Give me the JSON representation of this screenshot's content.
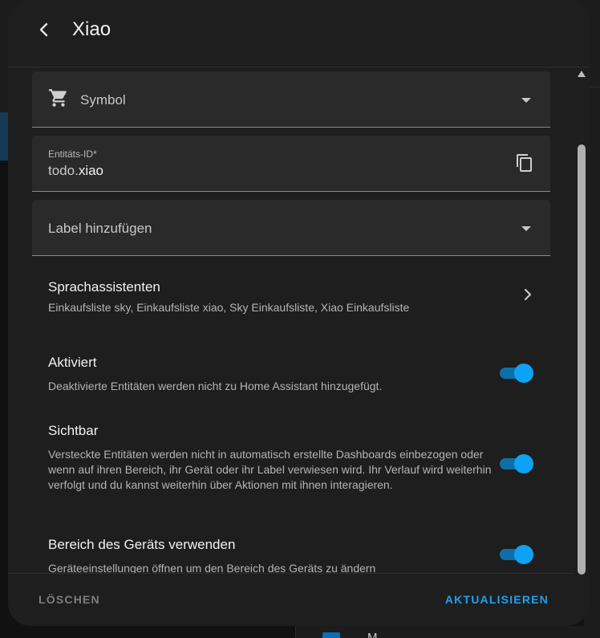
{
  "dialog": {
    "title": "Xiao"
  },
  "icon_field": {
    "label": "Symbol",
    "icon": "cart-icon"
  },
  "entity_field": {
    "label": "Entitäts-ID*",
    "prefix": "todo.",
    "value": "xiao"
  },
  "label_field": {
    "label": "Label hinzufügen"
  },
  "voice_assistants": {
    "title": "Sprachassistenten",
    "description": "Einkaufsliste sky, Einkaufsliste xiao, Sky Einkaufsliste, Xiao Einkaufsliste"
  },
  "settings": {
    "enabled": {
      "title": "Aktiviert",
      "description": "Deaktivierte Entitäten werden nicht zu Home Assistant hinzugefügt.",
      "on": true
    },
    "visible": {
      "title": "Sichtbar",
      "description": "Versteckte Entitäten werden nicht in automatisch erstellte Dashboards einbezogen oder wenn auf ihren Bereich, ihr Gerät oder ihr Label verwiesen wird. Ihr Verlauf wird weiterhin verfolgt und du kannst weiterhin über Aktionen mit ihnen interagieren.",
      "on": true
    },
    "device_area": {
      "title": "Bereich des Geräts verwenden",
      "description": "Geräteeinstellungen öffnen um den Bereich des Geräts zu ändern",
      "on": true
    }
  },
  "footer": {
    "delete_label": "LÖSCHEN",
    "update_label": "AKTUALISIEREN"
  },
  "background": {
    "row_text": "M"
  },
  "colors": {
    "accent": "#1ea1f2",
    "toggle_track": "#0e6fa8",
    "toggle_knob": "#0ea2f4",
    "dialog_bg": "#1e1e1e",
    "field_bg": "#2a2a2a"
  }
}
